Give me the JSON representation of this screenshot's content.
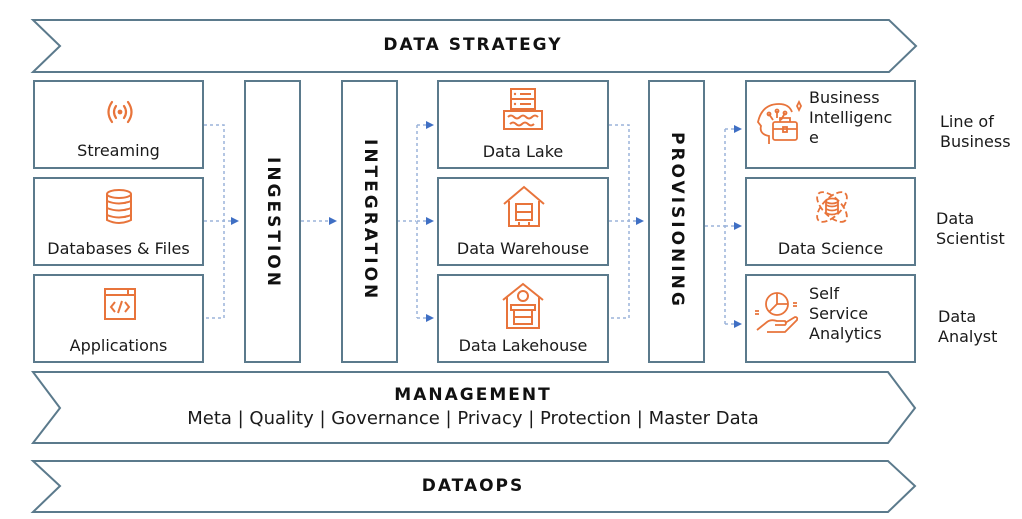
{
  "banners": {
    "strategy": "DATA STRATEGY",
    "management_title": "MANAGEMENT",
    "management_items": [
      "Meta",
      "Quality",
      "Governance",
      "Privacy",
      "Protection",
      "Master Data"
    ],
    "management_text": "Meta | Quality | Governance | Privacy | Protection | Master Data",
    "dataops": "DATAOPS"
  },
  "sources": [
    {
      "label": "Streaming",
      "icon": "broadcast-icon"
    },
    {
      "label": "Databases & Files",
      "icon": "database-icon"
    },
    {
      "label": "Applications",
      "icon": "code-window-icon"
    }
  ],
  "stages": {
    "ingestion": "INGESTION",
    "integration": "INTEGRATION",
    "provisioning": "PROVISIONING"
  },
  "storage": [
    {
      "label": "Data Lake",
      "icon": "server-lake-icon"
    },
    {
      "label": "Data Warehouse",
      "icon": "warehouse-server-icon"
    },
    {
      "label": "Data Lakehouse",
      "icon": "lakehouse-icon"
    }
  ],
  "consumers": [
    {
      "label_lines": [
        "Business",
        "Intelligenc",
        "e"
      ],
      "icon": "head-briefcase-icon"
    },
    {
      "label": "Data Science",
      "icon": "atom-database-icon"
    },
    {
      "label_lines": [
        "Self",
        "Service",
        "Analytics"
      ],
      "icon": "hand-pie-chart-icon"
    }
  ],
  "personas": [
    {
      "lines": [
        "Line of",
        "Business"
      ]
    },
    {
      "lines": [
        "Data",
        "Scientist"
      ]
    },
    {
      "lines": [
        "Data",
        "Analyst"
      ]
    }
  ],
  "colors": {
    "border": "#5b7a8c",
    "icon": "#e8743b",
    "arrow": "#3f6fc4",
    "connector": "#9bb4da"
  }
}
